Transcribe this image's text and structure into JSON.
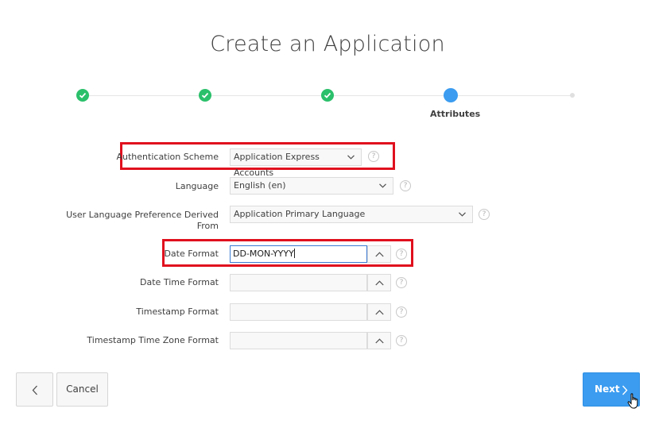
{
  "page": {
    "title": "Create an Application"
  },
  "wizard": {
    "current_step_label": "Attributes",
    "colors": {
      "done": "#2bc06b",
      "current": "#3b9cf0",
      "future": "#e0e0e0"
    }
  },
  "form": {
    "authentication_scheme": {
      "label": "Authentication Scheme",
      "value": "Application Express Accounts"
    },
    "language": {
      "label": "Language",
      "value": "English (en)"
    },
    "user_language_pref": {
      "label_line1": "User Language Preference Derived",
      "label_line2": "From",
      "value": "Application Primary Language"
    },
    "date_format": {
      "label": "Date Format",
      "value": "DD-MON-YYYY"
    },
    "date_time_format": {
      "label": "Date Time Format",
      "value": ""
    },
    "timestamp_format": {
      "label": "Timestamp Format",
      "value": ""
    },
    "timestamp_tz_format": {
      "label": "Timestamp Time Zone Format",
      "value": ""
    },
    "help_glyph": "?"
  },
  "buttons": {
    "cancel_label": "Cancel",
    "next_label": "Next"
  },
  "highlight_color": "#e0101e"
}
